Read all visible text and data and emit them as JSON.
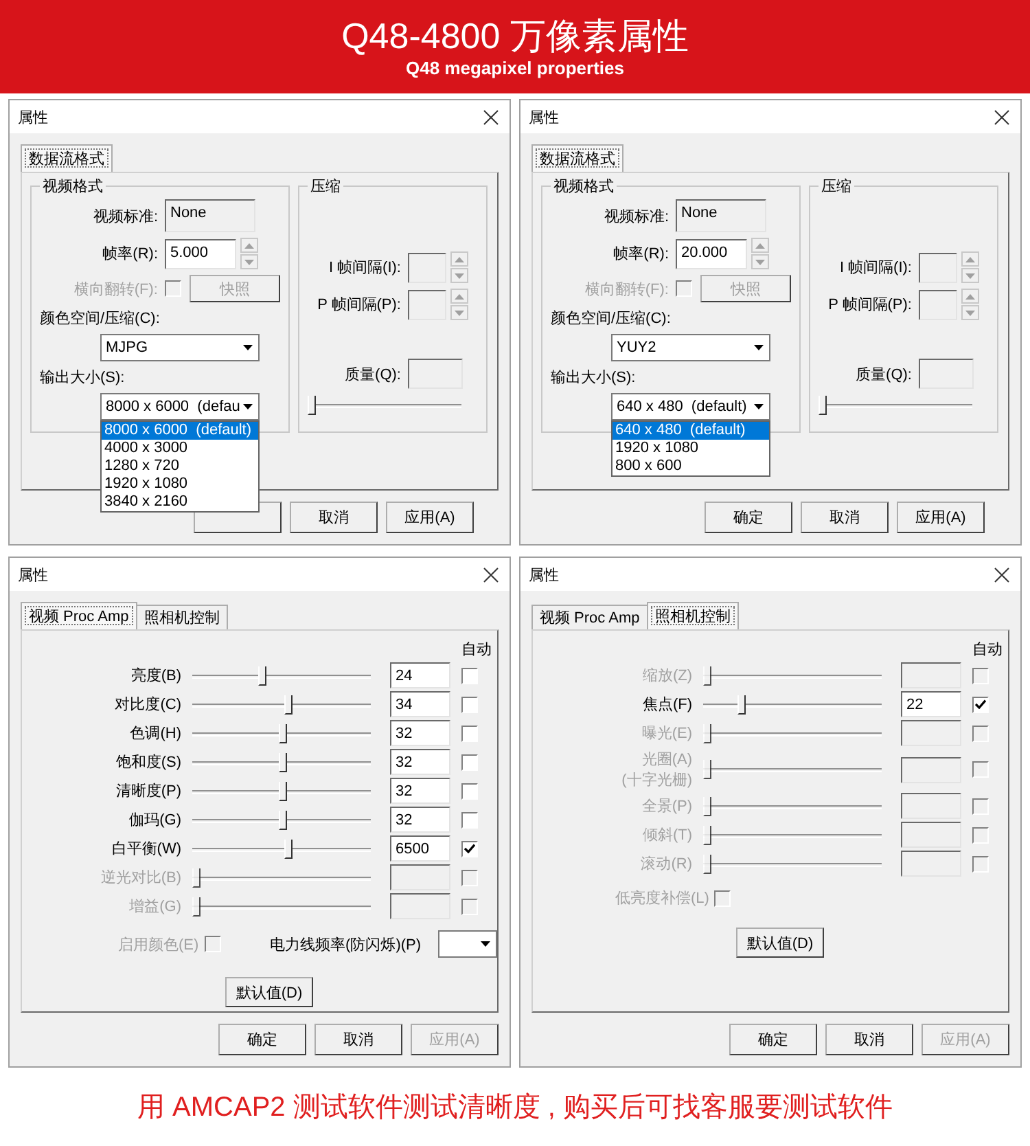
{
  "banner": {
    "title": "Q48-4800 万像素属性",
    "subtitle": "Q48 megapixel properties"
  },
  "dialogs": [
    {
      "kind": "format",
      "title": "属性",
      "tabs": [
        {
          "label": "数据流格式",
          "selected": true
        }
      ],
      "video_group": {
        "title": "视频格式",
        "standard_label": "视频标准:",
        "standard": "None",
        "rate_label": "帧率(R):",
        "rate": "5.000",
        "flip": {
          "label": "横向翻转(F):",
          "checked": false,
          "disabled": true
        },
        "snapshot": {
          "label": "快照",
          "disabled": true
        },
        "color_label": "颜色空间/压缩(C):",
        "colorspace": "MJPG",
        "size_label": "输出大小(S):",
        "size": "8000 x 6000  (defau",
        "size_options": [
          {
            "label": "8000 x 6000  (default)",
            "selected": true
          },
          {
            "label": "4000 x 3000",
            "selected": false
          },
          {
            "label": "1280 x 720",
            "selected": false
          },
          {
            "label": "1920 x 1080",
            "selected": false
          },
          {
            "label": "3840 x 2160",
            "selected": false
          }
        ]
      },
      "compress_group": {
        "title": "压缩",
        "i_label": "I 帧间隔(I):",
        "p_label": "P 帧间隔(P):",
        "quality_label": "质量(Q):",
        "quality_slider": {
          "level": 0
        }
      },
      "buttons": [
        {
          "kind": "covered"
        },
        {
          "kind": "button",
          "label": "取消",
          "disabled": false
        },
        {
          "kind": "button",
          "label": "应用(A)",
          "disabled": false
        }
      ]
    },
    {
      "kind": "format",
      "title": "属性",
      "tabs": [
        {
          "label": "数据流格式",
          "selected": true
        }
      ],
      "video_group": {
        "title": "视频格式",
        "standard_label": "视频标准:",
        "standard": "None",
        "rate_label": "帧率(R):",
        "rate": "20.000",
        "flip": {
          "label": "横向翻转(F):",
          "checked": false,
          "disabled": true
        },
        "snapshot": {
          "label": "快照",
          "disabled": true
        },
        "color_label": "颜色空间/压缩(C):",
        "colorspace": "YUY2",
        "size_label": "输出大小(S):",
        "size": "640 x 480  (default)",
        "size_options": [
          {
            "label": "640 x 480  (default)",
            "selected": true
          },
          {
            "label": "1920 x 1080",
            "selected": false
          },
          {
            "label": "800 x 600",
            "selected": false
          }
        ]
      },
      "compress_group": {
        "title": "压缩",
        "i_label": "I 帧间隔(I):",
        "p_label": "P 帧间隔(P):",
        "quality_label": "质量(Q):",
        "quality_slider": {
          "level": 0
        }
      },
      "buttons": [
        {
          "kind": "button",
          "label": "确定",
          "disabled": false
        },
        {
          "kind": "button",
          "label": "取消",
          "disabled": false
        },
        {
          "kind": "button",
          "label": "应用(A)",
          "disabled": false
        }
      ]
    },
    {
      "kind": "controls",
      "title": "属性",
      "tabs": [
        {
          "label": "视频 Proc Amp",
          "selected": true
        },
        {
          "label": "照相机控制",
          "selected": false
        }
      ],
      "auto_label": "自动",
      "rows": [
        {
          "label": "亮度(B)",
          "level": 0.39,
          "value": "24",
          "auto": false,
          "disabled": false
        },
        {
          "label": "对比度(C)",
          "level": 0.54,
          "value": "34",
          "auto": false,
          "disabled": false
        },
        {
          "label": "色调(H)",
          "level": 0.51,
          "value": "32",
          "auto": false,
          "disabled": false
        },
        {
          "label": "饱和度(S)",
          "level": 0.51,
          "value": "32",
          "auto": false,
          "disabled": false
        },
        {
          "label": "清晰度(P)",
          "level": 0.51,
          "value": "32",
          "auto": false,
          "disabled": false
        },
        {
          "label": "伽玛(G)",
          "level": 0.51,
          "value": "32",
          "auto": false,
          "disabled": false
        },
        {
          "label": "白平衡(W)",
          "level": 0.54,
          "value": "6500",
          "auto": true,
          "disabled": false
        },
        {
          "label": "逆光对比(B)",
          "level": 0,
          "auto": false,
          "disabled": true
        },
        {
          "label": "增益(G)",
          "level": 0,
          "auto": false,
          "disabled": true
        }
      ],
      "extras": [
        {
          "kind": "checkbox",
          "label": "启用颜色(E)",
          "checked": false,
          "disabled": true
        },
        {
          "kind": "dropdown",
          "label": "电力线频率(防闪烁)(P)"
        }
      ],
      "default_button": "默认值(D)",
      "buttons": [
        {
          "kind": "button",
          "label": "确定",
          "disabled": false
        },
        {
          "kind": "button",
          "label": "取消",
          "disabled": false
        },
        {
          "kind": "button",
          "label": "应用(A)",
          "disabled": true
        }
      ]
    },
    {
      "kind": "controls",
      "title": "属性",
      "tabs": [
        {
          "label": "视频 Proc Amp",
          "selected": false
        },
        {
          "label": "照相机控制",
          "selected": true
        }
      ],
      "auto_label": "自动",
      "rows": [
        {
          "label": "缩放(Z)",
          "level": 0,
          "auto": false,
          "disabled": true
        },
        {
          "label": "焦点(F)",
          "level": 0.2,
          "value": "22",
          "auto": true,
          "disabled": false
        },
        {
          "label": "曝光(E)",
          "level": 0,
          "auto": false,
          "disabled": true
        },
        {
          "label": "光圈(A)",
          "sublabel": "(十字光栅)",
          "level": 0,
          "auto": false,
          "disabled": true
        },
        {
          "label": "全景(P)",
          "level": 0,
          "auto": false,
          "disabled": true
        },
        {
          "label": "倾斜(T)",
          "level": 0,
          "auto": false,
          "disabled": true
        },
        {
          "label": "滚动(R)",
          "level": 0,
          "auto": false,
          "disabled": true
        }
      ],
      "extras": [
        {
          "kind": "checkbox",
          "label": "低亮度补偿(L)",
          "checked": false,
          "disabled": true
        }
      ],
      "default_button": "默认值(D)",
      "buttons": [
        {
          "kind": "button",
          "label": "确定",
          "disabled": false
        },
        {
          "kind": "button",
          "label": "取消",
          "disabled": false
        },
        {
          "kind": "button",
          "label": "应用(A)",
          "disabled": true
        }
      ]
    }
  ],
  "footer": "用 AMCAP2 测试软件测试清晰度 , 购买后可找客服要测试软件"
}
